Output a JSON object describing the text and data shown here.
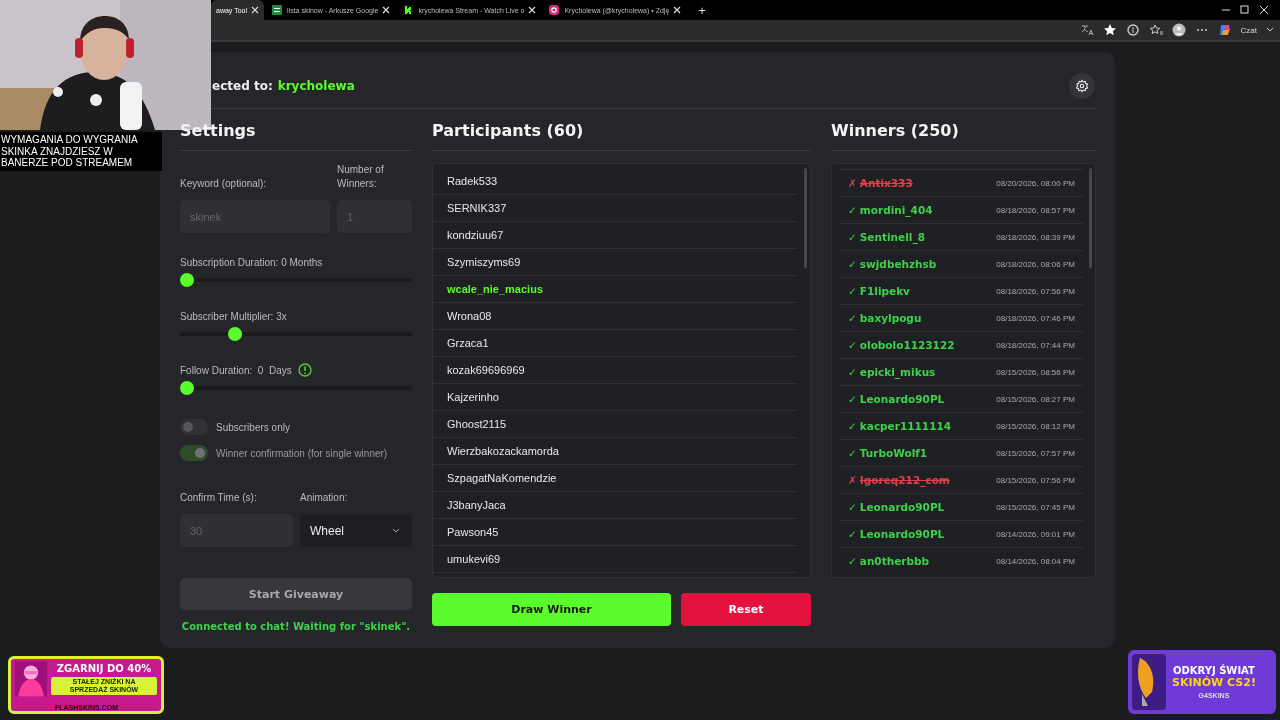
{
  "browser": {
    "tabs": [
      {
        "title": "away Tool",
        "selected": true
      },
      {
        "title": "lista skinow - Arkusze Google",
        "selected": false
      },
      {
        "title": "krycholewa Stream - Watch Live o",
        "selected": false
      },
      {
        "title": "Krycholewa (@krycholewa) • Zdję",
        "selected": false
      }
    ],
    "new_tab": "+",
    "chat_label": "Czat"
  },
  "stream_caption": "WYMAGANIA DO WYGRANIA SKINKA ZNAJDZIESZ W BANERZE POD STREAMEM",
  "app": {
    "connected_label": "ected to:",
    "channel": "krycholewa",
    "settings": {
      "title": "Settings",
      "keyword": {
        "label": "Keyword (optional):",
        "placeholder": "skinek"
      },
      "winners_count": {
        "label": "Number of Winners:",
        "placeholder": "1"
      },
      "sliders": [
        {
          "label": "Subscription Duration: 0 Months",
          "level": 0
        },
        {
          "label": "Subscriber Multiplier: 3x",
          "level": 0.22
        },
        {
          "label": "Follow Duration:  0  Days",
          "level": 0,
          "info": true
        }
      ],
      "toggles": [
        {
          "label": "Subscribers only",
          "on": false,
          "disabled": false
        },
        {
          "label": "Winner confirmation (for single winner)",
          "on": true,
          "disabled": true
        }
      ],
      "confirm_time": {
        "label": "Confirm Time (s):",
        "placeholder": "30"
      },
      "animation": {
        "label": "Animation:",
        "value": "Wheel"
      },
      "start_button": {
        "label": "Start Giveaway",
        "disabled": true
      },
      "status": "Connected to chat! Waiting for \"skinek\"."
    },
    "participants": {
      "title": "Participants (60)",
      "items": [
        {
          "name": "Radek533",
          "highlighted": false
        },
        {
          "name": "SERNIK337",
          "highlighted": false
        },
        {
          "name": "kondziuu67",
          "highlighted": false
        },
        {
          "name": "Szymiszyms69",
          "highlighted": false
        },
        {
          "name": "wcale_nie_macius",
          "highlighted": true
        },
        {
          "name": "Wrona08",
          "highlighted": false
        },
        {
          "name": "Grzaca1",
          "highlighted": false
        },
        {
          "name": "kozak69696969",
          "highlighted": false
        },
        {
          "name": "Kajzerinho",
          "highlighted": false
        },
        {
          "name": "Ghoost2115",
          "highlighted": false
        },
        {
          "name": "Wierzbakozackamorda",
          "highlighted": false
        },
        {
          "name": "SzpagatNaKomendzie",
          "highlighted": false
        },
        {
          "name": "J3banyJaca",
          "highlighted": false
        },
        {
          "name": "Pawson45",
          "highlighted": false
        },
        {
          "name": "umukevi69",
          "highlighted": false
        }
      ]
    },
    "winners": {
      "title": "Winners (250)",
      "items": [
        {
          "mark": "✗",
          "name": "Antix333",
          "rejected": true,
          "time": "08/20/2026, 08:00 PM"
        },
        {
          "mark": "✓",
          "name": "mordini_404",
          "rejected": false,
          "time": "08/18/2026, 08:57 PM"
        },
        {
          "mark": "✓",
          "name": "Sentinell_8",
          "rejected": false,
          "time": "08/18/2026, 08:39 PM"
        },
        {
          "mark": "✓",
          "name": "swjdbehzhsb",
          "rejected": false,
          "time": "08/18/2026, 08:06 PM"
        },
        {
          "mark": "✓",
          "name": "F1lipekv",
          "rejected": false,
          "time": "08/18/2026, 07:56 PM"
        },
        {
          "mark": "✓",
          "name": "baxylpogu",
          "rejected": false,
          "time": "08/18/2026, 07:46 PM"
        },
        {
          "mark": "✓",
          "name": "olobolo1123122",
          "rejected": false,
          "time": "08/18/2026, 07:44 PM"
        },
        {
          "mark": "✓",
          "name": "epicki_mikus",
          "rejected": false,
          "time": "08/15/2026, 08:56 PM"
        },
        {
          "mark": "✓",
          "name": "Leonardo90PL",
          "rejected": false,
          "time": "08/15/2026, 08:27 PM"
        },
        {
          "mark": "✓",
          "name": "kacper1111114",
          "rejected": false,
          "time": "08/15/2026, 08:12 PM"
        },
        {
          "mark": "✓",
          "name": "TurboWolf1",
          "rejected": false,
          "time": "08/15/2026, 07:57 PM"
        },
        {
          "mark": "✗",
          "name": "Igoreq212_com",
          "rejected": true,
          "time": "08/15/2026, 07:56 PM"
        },
        {
          "mark": "✓",
          "name": "Leonardo90PL",
          "rejected": false,
          "time": "08/15/2026, 07:45 PM"
        },
        {
          "mark": "✓",
          "name": "Leonardo90PL",
          "rejected": false,
          "time": "08/14/2026, 09:01 PM"
        },
        {
          "mark": "✓",
          "name": "an0therbbb",
          "rejected": false,
          "time": "08/14/2026, 08:04 PM"
        }
      ]
    },
    "draw_button": "Draw Winner",
    "reset_button": "Reset"
  },
  "ads": [
    {
      "kind": "flash",
      "headline": "ZGARNIJ DO 40%",
      "subline": "STAŁEJ ZNIŻKI NA SPRZEDAŻ SKINÓW",
      "brand": "FLASHSKINS.COM"
    },
    {
      "kind": "g4",
      "headline": "ODKRYJ ŚWIAT",
      "subline": "SKINÓW CS2!",
      "brand": "G4SKINS"
    }
  ]
}
